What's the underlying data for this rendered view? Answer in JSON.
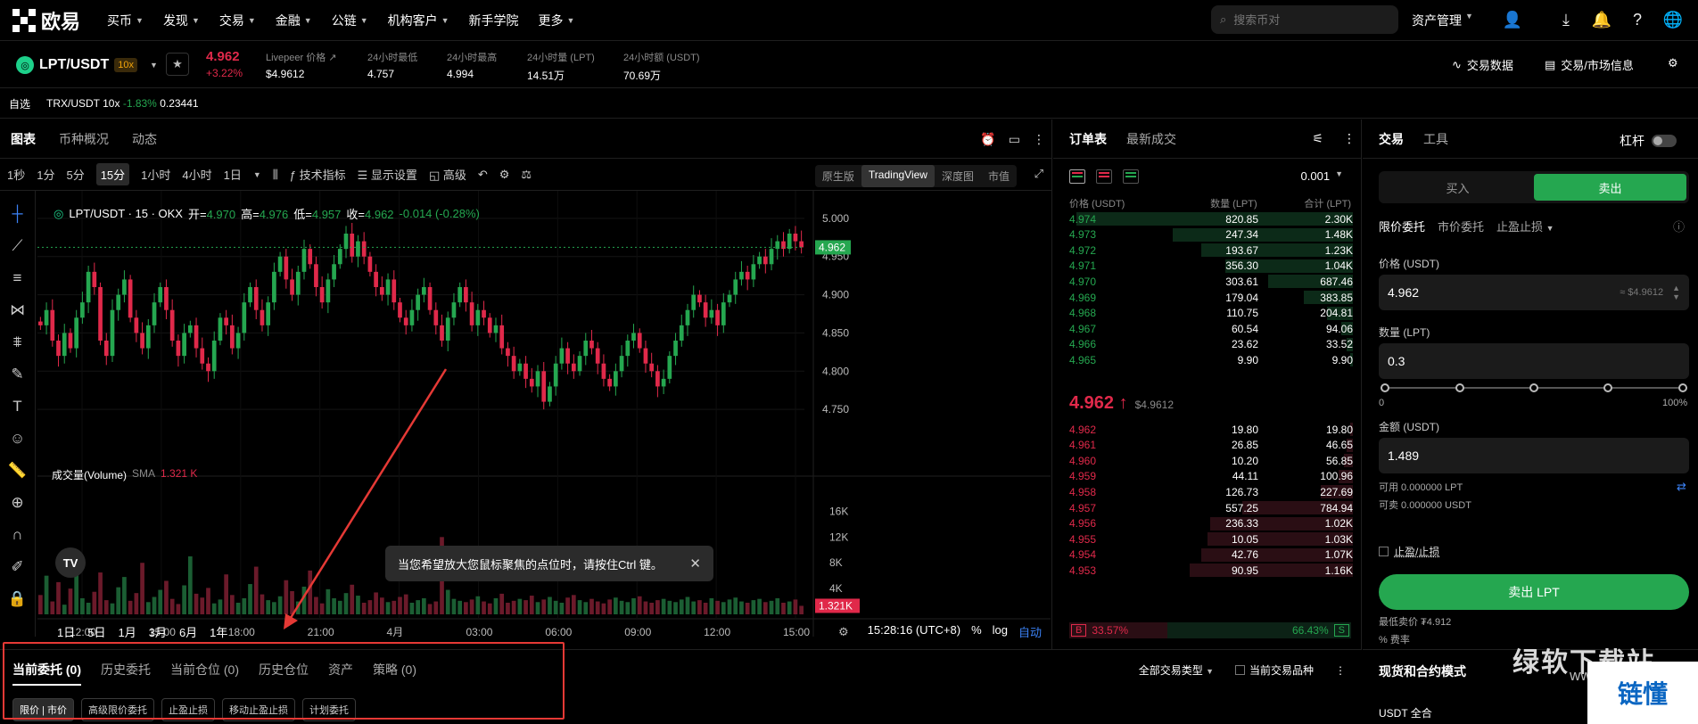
{
  "nav": {
    "logo": "欧易",
    "items": [
      "买币",
      "发现",
      "交易",
      "金融",
      "公链",
      "机构客户",
      "新手学院",
      "更多"
    ],
    "search_placeholder": "搜索币对",
    "assets_label": "资产管理"
  },
  "ticker": {
    "pair": "LPT/USDT",
    "leverage": "10x",
    "price": "4.962",
    "change": "+3.22%",
    "stats": [
      {
        "label": "Livepeer 价格 ↗",
        "value": "$4.9612"
      },
      {
        "label": "24小时最低",
        "value": "4.757"
      },
      {
        "label": "24小时最高",
        "value": "4.994"
      },
      {
        "label": "24小时量 (LPT)",
        "value": "14.51万"
      },
      {
        "label": "24小时额 (USDT)",
        "value": "70.69万"
      }
    ],
    "links": [
      "交易数据",
      "交易/市场信息"
    ]
  },
  "favbar": {
    "label": "自选",
    "pair": "TRX/USDT 10x",
    "change": "-1.83%",
    "price": "0.23441"
  },
  "chart_panel": {
    "tabs": [
      "图表",
      "币种概况",
      "动态"
    ],
    "intervals": [
      "1秒",
      "1分",
      "5分",
      "15分",
      "1小时",
      "4小时",
      "1日"
    ],
    "tools": [
      "技术指标",
      "显示设置",
      "高级"
    ],
    "modes": [
      "原生版",
      "TradingView",
      "深度图",
      "市值"
    ],
    "info": {
      "pair": "LPT/USDT · 15 · OKX",
      "open_l": "开=",
      "open": "4.970",
      "high_l": "高=",
      "high": "4.976",
      "low_l": "低=",
      "low": "4.957",
      "close_l": "收=",
      "close": "4.962",
      "delta": "-0.014 (-0.28%)"
    },
    "volume_label": "成交量(Volume)",
    "volume_sma": "SMA",
    "volume_value": "1.321 K",
    "tooltip": "当您希望放大您鼠标聚焦的点位时，请按住Ctrl 键。",
    "periods": [
      "1日",
      "5日",
      "1月",
      "3月",
      "6月",
      "1年"
    ],
    "clock": "15:28:16 (UTC+8)",
    "pct": "%",
    "log": "log",
    "auto": "自动"
  },
  "chart_data": {
    "type": "candlestick",
    "price_ticks": [
      "5.000",
      "4.950",
      "4.900",
      "4.850",
      "4.800",
      "4.750"
    ],
    "price_tick_values": [
      5.0,
      4.95,
      4.9,
      4.85,
      4.8,
      4.75
    ],
    "price_range": [
      4.735,
      5.015
    ],
    "last_price": "4.962",
    "volume_ticks": [
      "16K",
      "12K",
      "8K",
      "4K"
    ],
    "volume_tick_values": [
      16000,
      12000,
      8000,
      4000
    ],
    "last_volume": "1.321K",
    "time_labels": [
      "12:00",
      "15:00",
      "18:00",
      "21:00",
      "4月",
      "03:00",
      "06:00",
      "09:00",
      "12:00",
      "15:00"
    ],
    "closes": [
      4.86,
      4.88,
      4.84,
      4.82,
      4.85,
      4.83,
      4.87,
      4.89,
      4.93,
      4.91,
      4.84,
      4.82,
      4.88,
      4.9,
      4.92,
      4.87,
      4.85,
      4.83,
      4.86,
      4.89,
      4.91,
      4.88,
      4.84,
      4.82,
      4.85,
      4.86,
      4.83,
      4.81,
      4.8,
      4.84,
      4.87,
      4.86,
      4.83,
      4.85,
      4.89,
      4.91,
      4.88,
      4.86,
      4.89,
      4.93,
      4.95,
      4.92,
      4.9,
      4.93,
      4.96,
      4.94,
      4.91,
      4.89,
      4.92,
      4.94,
      4.96,
      4.98,
      4.95,
      4.97,
      4.95,
      4.93,
      4.91,
      4.9,
      4.92,
      4.89,
      4.87,
      4.86,
      4.88,
      4.9,
      4.91,
      4.88,
      4.86,
      4.84,
      4.87,
      4.89,
      4.91,
      4.89,
      4.86,
      4.88,
      4.87,
      4.85,
      4.86,
      4.83,
      4.82,
      4.8,
      4.81,
      4.79,
      4.78,
      4.8,
      4.76,
      4.78,
      4.81,
      4.83,
      4.81,
      4.8,
      4.82,
      4.84,
      4.83,
      4.81,
      4.79,
      4.78,
      4.8,
      4.82,
      4.84,
      4.85,
      4.83,
      4.81,
      4.8,
      4.78,
      4.79,
      4.82,
      4.84,
      4.86,
      4.88,
      4.9,
      4.89,
      4.87,
      4.88,
      4.86,
      4.89,
      4.9,
      4.92,
      4.93,
      4.92,
      4.94,
      4.95,
      4.94,
      4.96,
      4.97,
      4.96,
      4.98,
      4.97,
      4.962
    ],
    "volumes": [
      3000,
      6000,
      2000,
      5000,
      1500,
      4000,
      7000,
      2500,
      1800,
      3500,
      6500,
      2200,
      1700,
      4200,
      5800,
      2100,
      3300,
      8000,
      1900,
      2700,
      3800,
      5200,
      2400,
      1600,
      4500,
      9000,
      3200,
      2600,
      4100,
      1700,
      2300,
      6200,
      3000,
      1800,
      2500,
      4700,
      7400,
      3100,
      2200,
      1900,
      2800,
      5300,
      3600,
      2000,
      4300,
      6800,
      2700,
      1700,
      3900,
      2500,
      2100,
      3300,
      4600,
      2900,
      1800,
      2200,
      3400,
      2600,
      1900,
      2100,
      2700,
      3100,
      1800,
      2200,
      2500,
      1600,
      2000,
      12000,
      3800,
      2400,
      2100,
      1900,
      2300,
      2800,
      2000,
      1700,
      2500,
      3200,
      1800,
      2100,
      2400,
      2200,
      2900,
      1900,
      2300,
      2700,
      2100,
      1800,
      2600,
      3000,
      2200,
      1900,
      2400,
      2000,
      1700,
      2300,
      2600,
      2100,
      1900,
      2500,
      2800,
      2000,
      1800,
      2200,
      2400,
      2100,
      1900,
      2300,
      2700,
      2000,
      2200,
      1800,
      2500,
      2100,
      1900,
      2300,
      2600,
      2000,
      1800,
      2200,
      2400,
      1900,
      2100,
      2500,
      1800,
      2000,
      2300,
      1321
    ]
  },
  "order_book": {
    "tabs": [
      "订单表",
      "最新成交"
    ],
    "precision": "0.001",
    "headers": [
      "价格 (USDT)",
      "数量 (LPT)",
      "合计 (LPT)"
    ],
    "asks": [
      {
        "price": "4.974",
        "qty": "820.85",
        "total": "2.30K",
        "depth": 0.95
      },
      {
        "price": "4.973",
        "qty": "247.34",
        "total": "1.48K",
        "depth": 0.62
      },
      {
        "price": "4.972",
        "qty": "193.67",
        "total": "1.23K",
        "depth": 0.52
      },
      {
        "price": "4.971",
        "qty": "356.30",
        "total": "1.04K",
        "depth": 0.44
      },
      {
        "price": "4.970",
        "qty": "303.61",
        "total": "687.46",
        "depth": 0.29
      },
      {
        "price": "4.969",
        "qty": "179.04",
        "total": "383.85",
        "depth": 0.17
      },
      {
        "price": "4.968",
        "qty": "110.75",
        "total": "204.81",
        "depth": 0.09
      },
      {
        "price": "4.967",
        "qty": "60.54",
        "total": "94.06",
        "depth": 0.04
      },
      {
        "price": "4.966",
        "qty": "23.62",
        "total": "33.52",
        "depth": 0.02
      },
      {
        "price": "4.965",
        "qty": "9.90",
        "total": "9.90",
        "depth": 0.01
      }
    ],
    "mid_price": "4.962 ↑",
    "mid_usd": "$4.9612",
    "bids": [
      {
        "price": "4.962",
        "qty": "19.80",
        "total": "19.80",
        "depth": 0.01
      },
      {
        "price": "4.961",
        "qty": "26.85",
        "total": "46.65",
        "depth": 0.02
      },
      {
        "price": "4.960",
        "qty": "10.20",
        "total": "56.85",
        "depth": 0.03
      },
      {
        "price": "4.959",
        "qty": "44.11",
        "total": "100.96",
        "depth": 0.05
      },
      {
        "price": "4.958",
        "qty": "126.73",
        "total": "227.69",
        "depth": 0.11
      },
      {
        "price": "4.957",
        "qty": "557.25",
        "total": "784.94",
        "depth": 0.38
      },
      {
        "price": "4.956",
        "qty": "236.33",
        "total": "1.02K",
        "depth": 0.49
      },
      {
        "price": "4.955",
        "qty": "10.05",
        "total": "1.03K",
        "depth": 0.5
      },
      {
        "price": "4.954",
        "qty": "42.76",
        "total": "1.07K",
        "depth": 0.52
      },
      {
        "price": "4.953",
        "qty": "90.95",
        "total": "1.16K",
        "depth": 0.56
      }
    ],
    "buy_badge": "B",
    "buy_ratio": "33.57%",
    "sell_ratio": "66.43%",
    "sell_badge": "S"
  },
  "trade": {
    "tabs": [
      "交易",
      "工具"
    ],
    "leverage_label": "杠杆",
    "buy_label": "买入",
    "sell_label": "卖出",
    "order_types": [
      "限价委托",
      "市价委托",
      "止盈止损"
    ],
    "price_label": "价格 (USDT)",
    "price_value": "4.962",
    "price_hint": "≈ $4.9612",
    "qty_label": "数量 (LPT)",
    "qty_value": "0.3",
    "slider_min": "0",
    "slider_max": "100%",
    "amount_label": "金额 (USDT)",
    "amount_value": "1.489",
    "available": "可用 0.000000 LPT",
    "sellable": "可卖 0.000000 USDT",
    "tpsl": "止盈/止损",
    "submit": "卖出 LPT",
    "min_sell": "最低卖价 ₮4.912",
    "fee": "% 费率",
    "mode_title": "现货和合约模式",
    "account": "USDT 全合"
  },
  "bottom": {
    "tabs": [
      "当前委托 (0)",
      "历史委托",
      "当前仓位 (0)",
      "历史仓位",
      "资产",
      "策略 (0)"
    ],
    "filter_type": "全部交易类型",
    "filter_current": "当前交易品种",
    "chips": [
      "限价 | 市价",
      "高级限价委托",
      "止盈止损",
      "移动止盈止损",
      "计划委托"
    ]
  },
  "watermark": {
    "text1": "绿软下载站",
    "text2": "www.itmop.com",
    "badge": "链懂"
  }
}
